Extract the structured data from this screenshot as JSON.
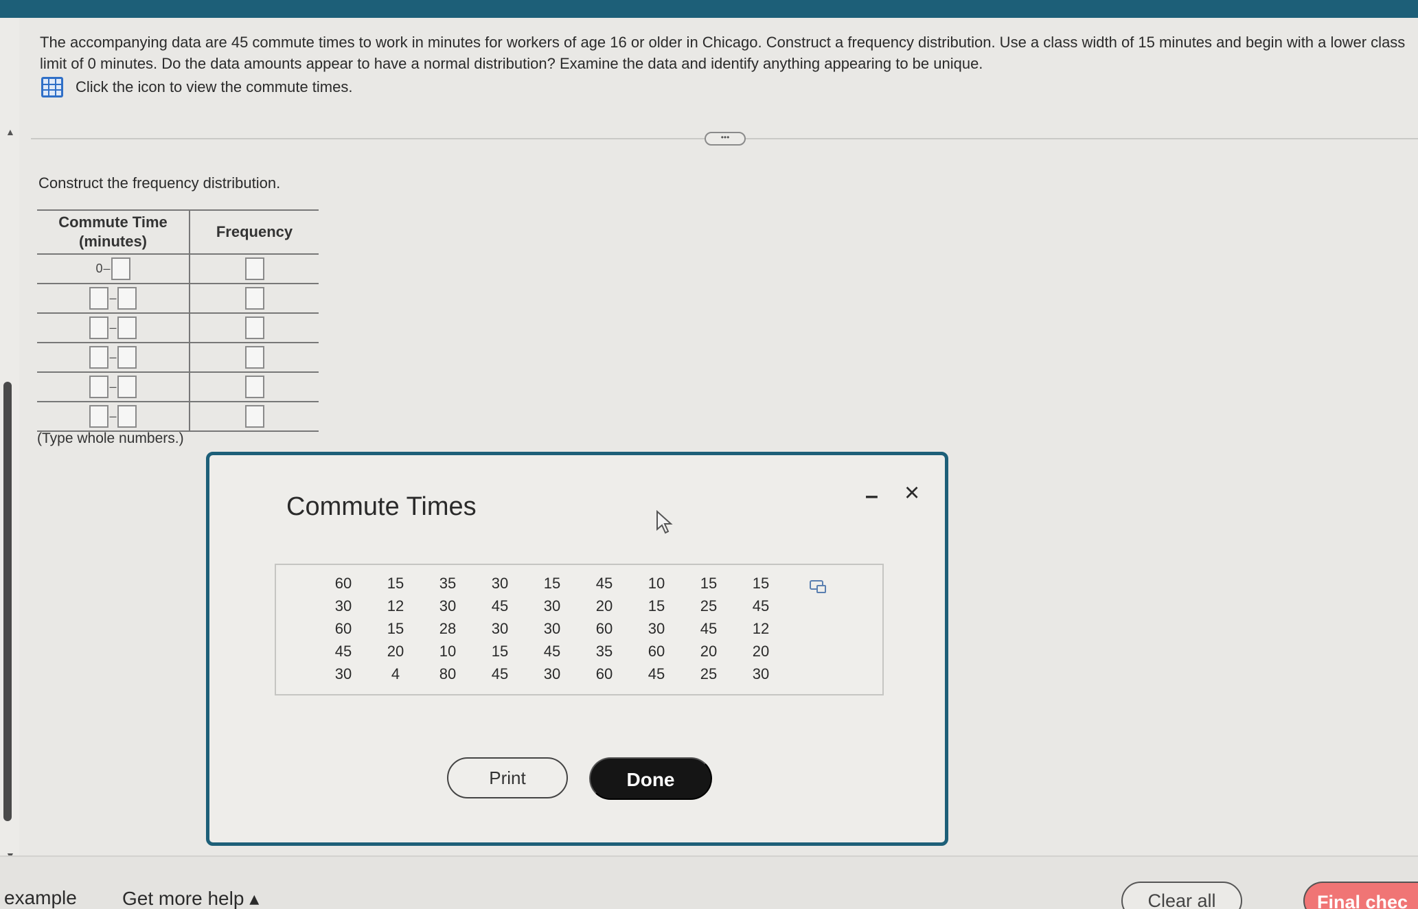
{
  "question": {
    "text": "The accompanying data are 45 commute times to work in minutes for workers of age 16 or older in Chicago. Construct a frequency distribution. Use a class width of 15 minutes and begin with a lower class limit of 0 minutes. Do the data amounts appear to have a normal distribution? Examine the data and identify anything appearing to be unique.",
    "icon_link_text": "Click the icon to view the commute times.",
    "icon": "grid-icon"
  },
  "expander": {
    "label": "•••"
  },
  "construct_label": "Construct the frequency distribution.",
  "freq_table": {
    "headers": [
      "Commute Time (minutes)",
      "Frequency"
    ],
    "first_lower_limit": "0",
    "dash": "–",
    "rows": 6
  },
  "type_note": "(Type whole numbers.)",
  "dialog": {
    "title": "Commute Times",
    "minimize_symbol": "–",
    "close_symbol": "×",
    "data_rows": [
      [
        "60",
        "15",
        "35",
        "30",
        "15",
        "45",
        "10",
        "15",
        "15"
      ],
      [
        "30",
        "12",
        "30",
        "45",
        "30",
        "20",
        "15",
        "25",
        "45"
      ],
      [
        "60",
        "15",
        "28",
        "30",
        "30",
        "60",
        "30",
        "45",
        "12"
      ],
      [
        "45",
        "20",
        "10",
        "15",
        "45",
        "35",
        "60",
        "20",
        "20"
      ],
      [
        "30",
        "4",
        "80",
        "45",
        "30",
        "60",
        "45",
        "25",
        "30"
      ]
    ],
    "print_label": "Print",
    "done_label": "Done"
  },
  "bottom": {
    "example_label": "example",
    "help_label": "Get more help ▴",
    "clear_label": "Clear all",
    "final_label": "Final chec"
  },
  "colors": {
    "topbar": "#1d5f78",
    "dialog_border": "#1d5f78",
    "done_button": "#151515",
    "final_button": "#f07575",
    "grid_icon": "#2f6fc7"
  }
}
